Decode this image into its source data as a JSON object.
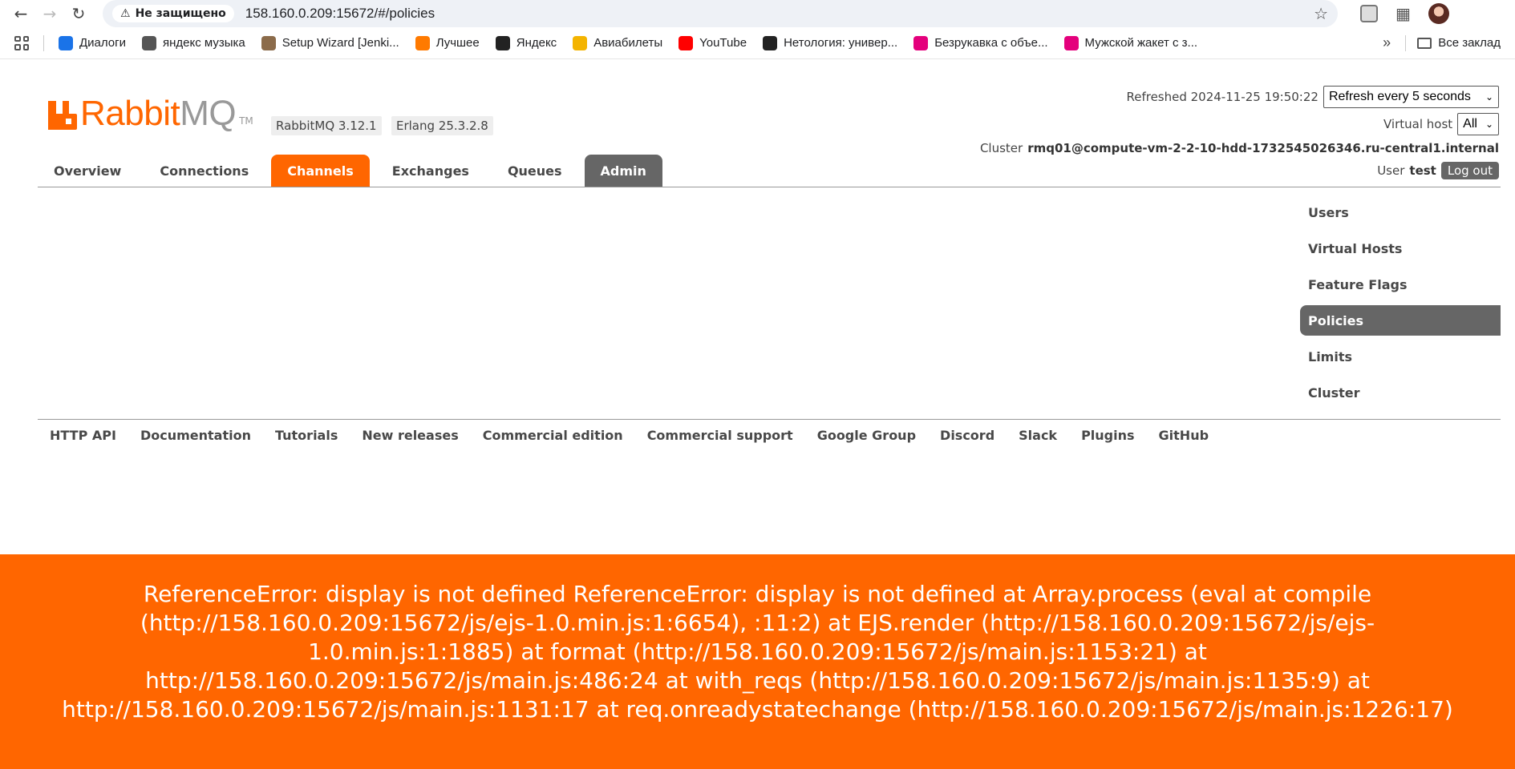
{
  "browser": {
    "security_label": "Не защищено",
    "url": "158.160.0.209:15672/#/policies",
    "bookmarks": [
      {
        "label": "Диалоги",
        "color": "#1a73e8"
      },
      {
        "label": "яндекс музыка",
        "color": "#555555"
      },
      {
        "label": "Setup Wizard [Jenki...",
        "color": "#8b6b4a"
      },
      {
        "label": "Лучшее",
        "color": "#ff7a00"
      },
      {
        "label": "Яндекс",
        "color": "#222222"
      },
      {
        "label": "Авиабилеты",
        "color": "#f4b400"
      },
      {
        "label": "YouTube",
        "color": "#ff0000"
      },
      {
        "label": "Нетология: универ...",
        "color": "#222222"
      },
      {
        "label": "Безрукавка с объе...",
        "color": "#e4007c"
      },
      {
        "label": "Мужской жакет с з...",
        "color": "#e4007c"
      }
    ],
    "all_bookmarks": "Все заклад"
  },
  "header": {
    "logo_rabbit": "Rabbit",
    "logo_mq": "MQ",
    "logo_tm": "TM",
    "version_rabbit": "RabbitMQ 3.12.1",
    "version_erlang": "Erlang 25.3.2.8",
    "refreshed_label": "Refreshed 2024-11-25 19:50:22",
    "refresh_select": "Refresh every 5 seconds",
    "vhost_label": "Virtual host",
    "vhost_select": "All",
    "cluster_label": "Cluster",
    "cluster_name": "rmq01@compute-vm-2-2-10-hdd-1732545026346.ru-central1.internal",
    "user_label": "User",
    "user_name": "test",
    "logout": "Log out"
  },
  "tabs": [
    "Overview",
    "Connections",
    "Channels",
    "Exchanges",
    "Queues",
    "Admin"
  ],
  "side_menu": [
    "Users",
    "Virtual Hosts",
    "Feature Flags",
    "Policies",
    "Limits",
    "Cluster"
  ],
  "footer_links": [
    "HTTP API",
    "Documentation",
    "Tutorials",
    "New releases",
    "Commercial edition",
    "Commercial support",
    "Google Group",
    "Discord",
    "Slack",
    "Plugins",
    "GitHub"
  ],
  "error": {
    "message": "ReferenceError: display is not defined ReferenceError: display is not defined at Array.process (eval at compile (http://158.160.0.209:15672/js/ejs-1.0.min.js:1:6654), :11:2) at EJS.render (http://158.160.0.209:15672/js/ejs-1.0.min.js:1:1885) at format (http://158.160.0.209:15672/js/main.js:1153:21) at http://158.160.0.209:15672/js/main.js:486:24 at with_reqs (http://158.160.0.209:15672/js/main.js:1135:9) at http://158.160.0.209:15672/js/main.js:1131:17 at req.onreadystatechange (http://158.160.0.209:15672/js/main.js:1226:17)"
  },
  "colors": {
    "brand": "#ff6600",
    "admin_tab": "#666666"
  }
}
